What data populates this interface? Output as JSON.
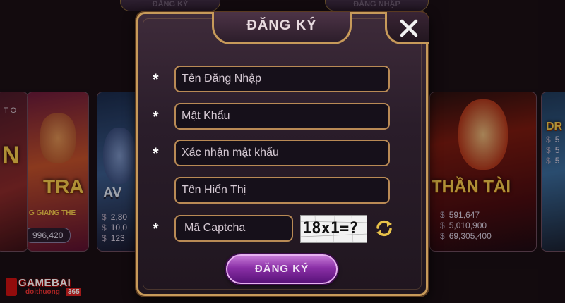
{
  "background": {
    "top_tabs": [
      "ĐĂNG KÝ",
      "ĐĂNG NHẬP"
    ],
    "cards": [
      {
        "name": "left-edge",
        "label": "T O",
        "title": "N",
        "pill": "996,420"
      },
      {
        "name": "na-tra",
        "title": "TRA",
        "subtitle": "G GIANG THE",
        "pill": "996,420"
      },
      {
        "name": "avengers",
        "title": "AV",
        "stats": [
          "2,80",
          "10,0",
          "123"
        ]
      },
      {
        "name": "than-tai",
        "title": "THẦN TÀI",
        "stats": [
          "591,647",
          "5,010,900",
          "69,305,400"
        ]
      },
      {
        "name": "right-edge",
        "title": "DR",
        "stats": [
          "5",
          "5",
          "5"
        ]
      }
    ],
    "logo": {
      "main": "GAMEBAI",
      "sub": "doithuong",
      "num": "365"
    }
  },
  "modal": {
    "title": "ĐĂNG KÝ",
    "required_mark": "*",
    "fields": {
      "username_placeholder": "Tên Đăng Nhập",
      "password_placeholder": "Mật Khẩu",
      "confirm_placeholder": "Xác nhận mật khẩu",
      "display_name_placeholder": "Tên Hiển Thị",
      "captcha_placeholder": "Mã Captcha"
    },
    "captcha_text": "18x1=?",
    "submit_label": "ĐĂNG KÝ",
    "accent": "#c79a5a",
    "button_color": "#8a2fa6"
  }
}
